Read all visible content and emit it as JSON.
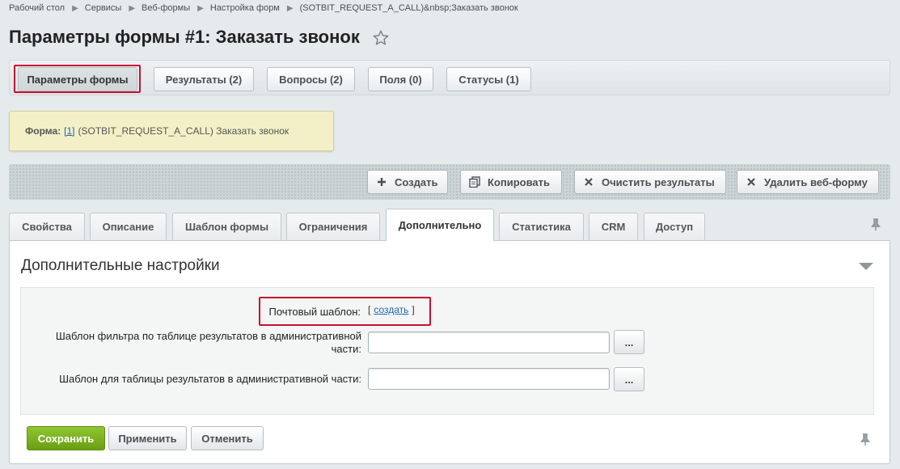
{
  "breadcrumb": [
    "Рабочий стол",
    "Сервисы",
    "Веб-формы",
    "Настройка форм",
    "(SOTBIT_REQUEST_A_CALL)&nbsp;Заказать звонок"
  ],
  "page_title": "Параметры формы #1: Заказать звонок",
  "top_tabs": [
    "Параметры формы",
    "Результаты (2)",
    "Вопросы (2)",
    "Поля (0)",
    "Статусы (1)"
  ],
  "info": {
    "label": "Форма:",
    "link": "[1]",
    "text": "(SOTBIT_REQUEST_A_CALL) Заказать звонок"
  },
  "toolbar": {
    "create": "Создать",
    "copy": "Копировать",
    "clear_results": "Очистить результаты",
    "delete_form": "Удалить веб-форму"
  },
  "form_tabs": [
    "Свойства",
    "Описание",
    "Шаблон формы",
    "Ограничения",
    "Дополнительно",
    "Статистика",
    "CRM",
    "Доступ"
  ],
  "section": {
    "title": "Дополнительные настройки",
    "mail_template_label": "Почтовый шаблон:",
    "mail_template_open": "[",
    "mail_template_link": "создать",
    "mail_template_close": "]",
    "filter_template_label": "Шаблон фильтра по таблице результатов в административной части:",
    "filter_template_value": "",
    "table_template_label": "Шаблон для таблицы результатов в административной части:",
    "table_template_value": "",
    "browse_label": "..."
  },
  "buttons": {
    "save": "Сохранить",
    "apply": "Применить",
    "cancel": "Отменить"
  },
  "colors": {
    "accent_green": "#7ab21f",
    "highlight_red": "#c8102e",
    "link_blue": "#2067b0"
  }
}
